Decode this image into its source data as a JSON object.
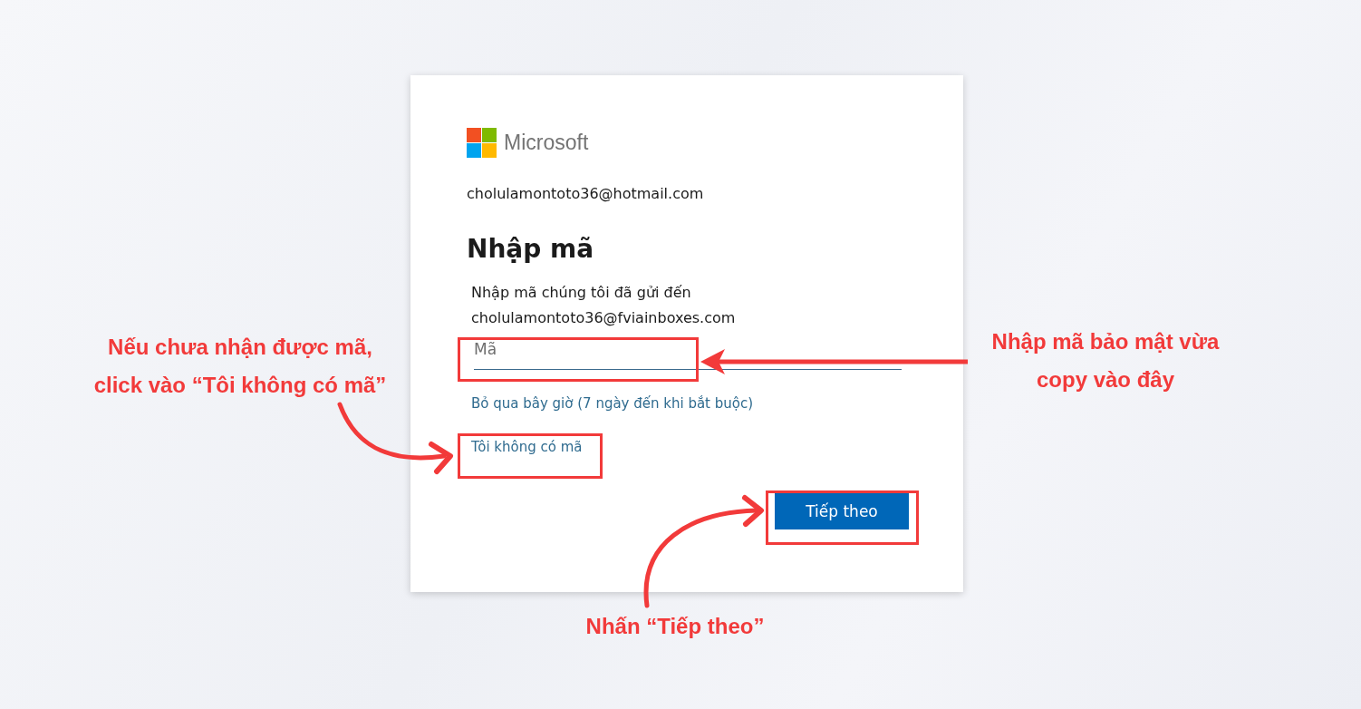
{
  "card": {
    "brand": "Microsoft",
    "account": "cholulamontoto36@hotmail.com",
    "heading": "Nhập mã",
    "description": "Nhập mã chúng tôi đã gửi đến cholulamontoto36@fviainboxes.com",
    "code_field": {
      "placeholder": "Mã"
    },
    "skip_link": "Bỏ qua bây giờ (7 ngày đến khi bắt buộc)",
    "no_code_link": "Tôi không có mã",
    "next_button": "Tiếp theo"
  },
  "annotations": [
    {
      "kind": "left",
      "text": "Nếu chưa nhận được mã, click vào “Tôi không có mã”"
    },
    {
      "kind": "right",
      "text": "Nhập mã bảo mật vừa copy vào đây"
    },
    {
      "kind": "bottom",
      "text": "Nhấn “Tiếp theo”"
    }
  ]
}
